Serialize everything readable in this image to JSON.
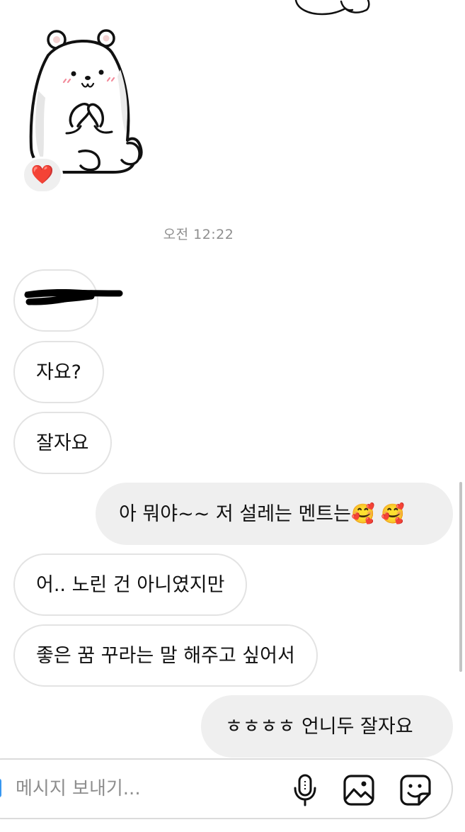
{
  "thread": {
    "timestamp": "오전 12:22",
    "reaction_emoji": "❤️",
    "messages": [
      {
        "id": "m1",
        "side": "incoming",
        "text": "",
        "redacted": true
      },
      {
        "id": "m2",
        "side": "incoming",
        "text": "자요?"
      },
      {
        "id": "m3",
        "side": "incoming",
        "text": "잘자요"
      },
      {
        "id": "m4",
        "side": "outgoing",
        "text": "아 뭐야~~ 저 설레는 멘트는🥰 🥰"
      },
      {
        "id": "m5",
        "side": "incoming",
        "text": "어.. 노린 건 아니였지만"
      },
      {
        "id": "m6",
        "side": "incoming",
        "text": "좋은 꿈 꾸라는 말 해주고 싶어서"
      },
      {
        "id": "m7",
        "side": "outgoing",
        "text": "ㅎㅎㅎㅎ 언니두 잘자요"
      }
    ]
  },
  "composer": {
    "placeholder": "메시지 보내기...",
    "value": "",
    "icons": [
      "microphone-icon",
      "gallery-icon",
      "sticker-icon"
    ]
  },
  "colors": {
    "incoming_border": "#e3e3e3",
    "outgoing_bg": "#efefef",
    "timestamp": "#8e8e8e",
    "reaction_heart": "#e0243a",
    "accent_cursor": "#3897f0"
  }
}
